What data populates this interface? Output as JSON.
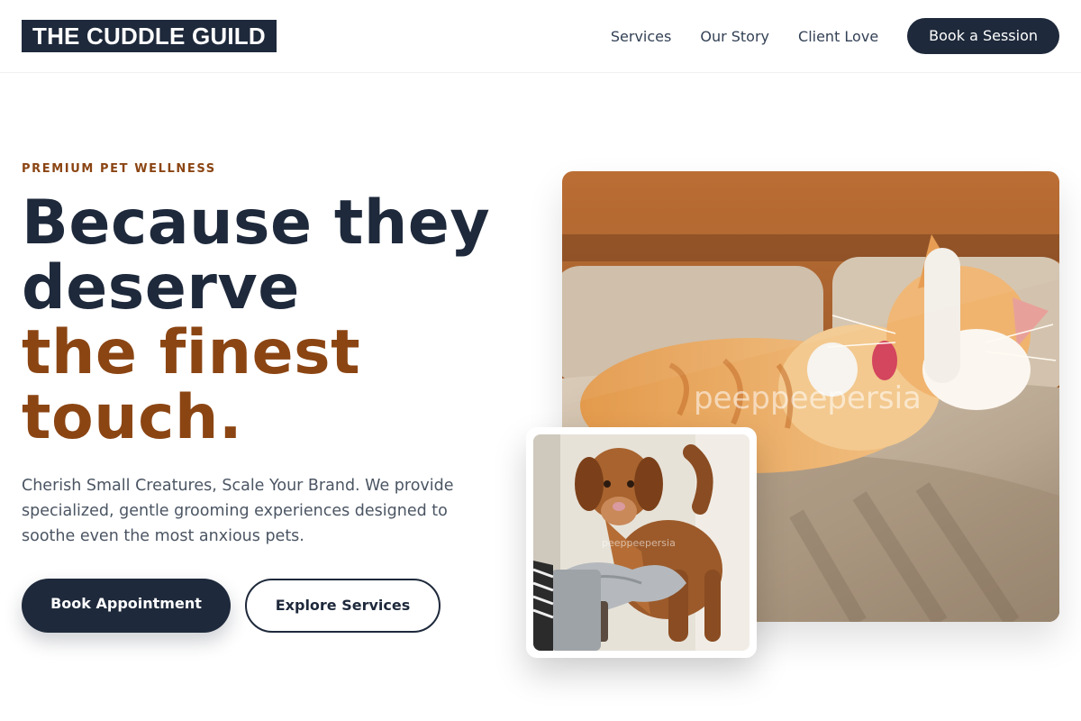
{
  "header": {
    "logo_text": "THE CUDDLE GUILD",
    "nav": [
      {
        "label": "Services"
      },
      {
        "label": "Our Story"
      },
      {
        "label": "Client Love"
      }
    ],
    "cta_label": "Book a Session"
  },
  "hero": {
    "eyebrow": "PREMIUM PET WELLNESS",
    "headline_line1": "Because they",
    "headline_line2": "deserve",
    "headline_line3": "the finest",
    "headline_line4": "touch.",
    "description": "Cherish Small Creatures, Scale Your Brand. We provide specialized, gentle grooming experiences designed to soothe even the most anxious pets.",
    "primary_button": "Book Appointment",
    "secondary_button": "Explore Services"
  },
  "images": {
    "main_alt": "Orange and white cat stretching on a beige couch",
    "main_watermark": "peeppeepersia",
    "secondary_alt": "Brown dog being dried with a grey towel glove",
    "secondary_watermark": "peeppeepersia"
  },
  "colors": {
    "primary": "#1e293b",
    "accent": "#8b4513",
    "text_muted": "#4b5563"
  }
}
